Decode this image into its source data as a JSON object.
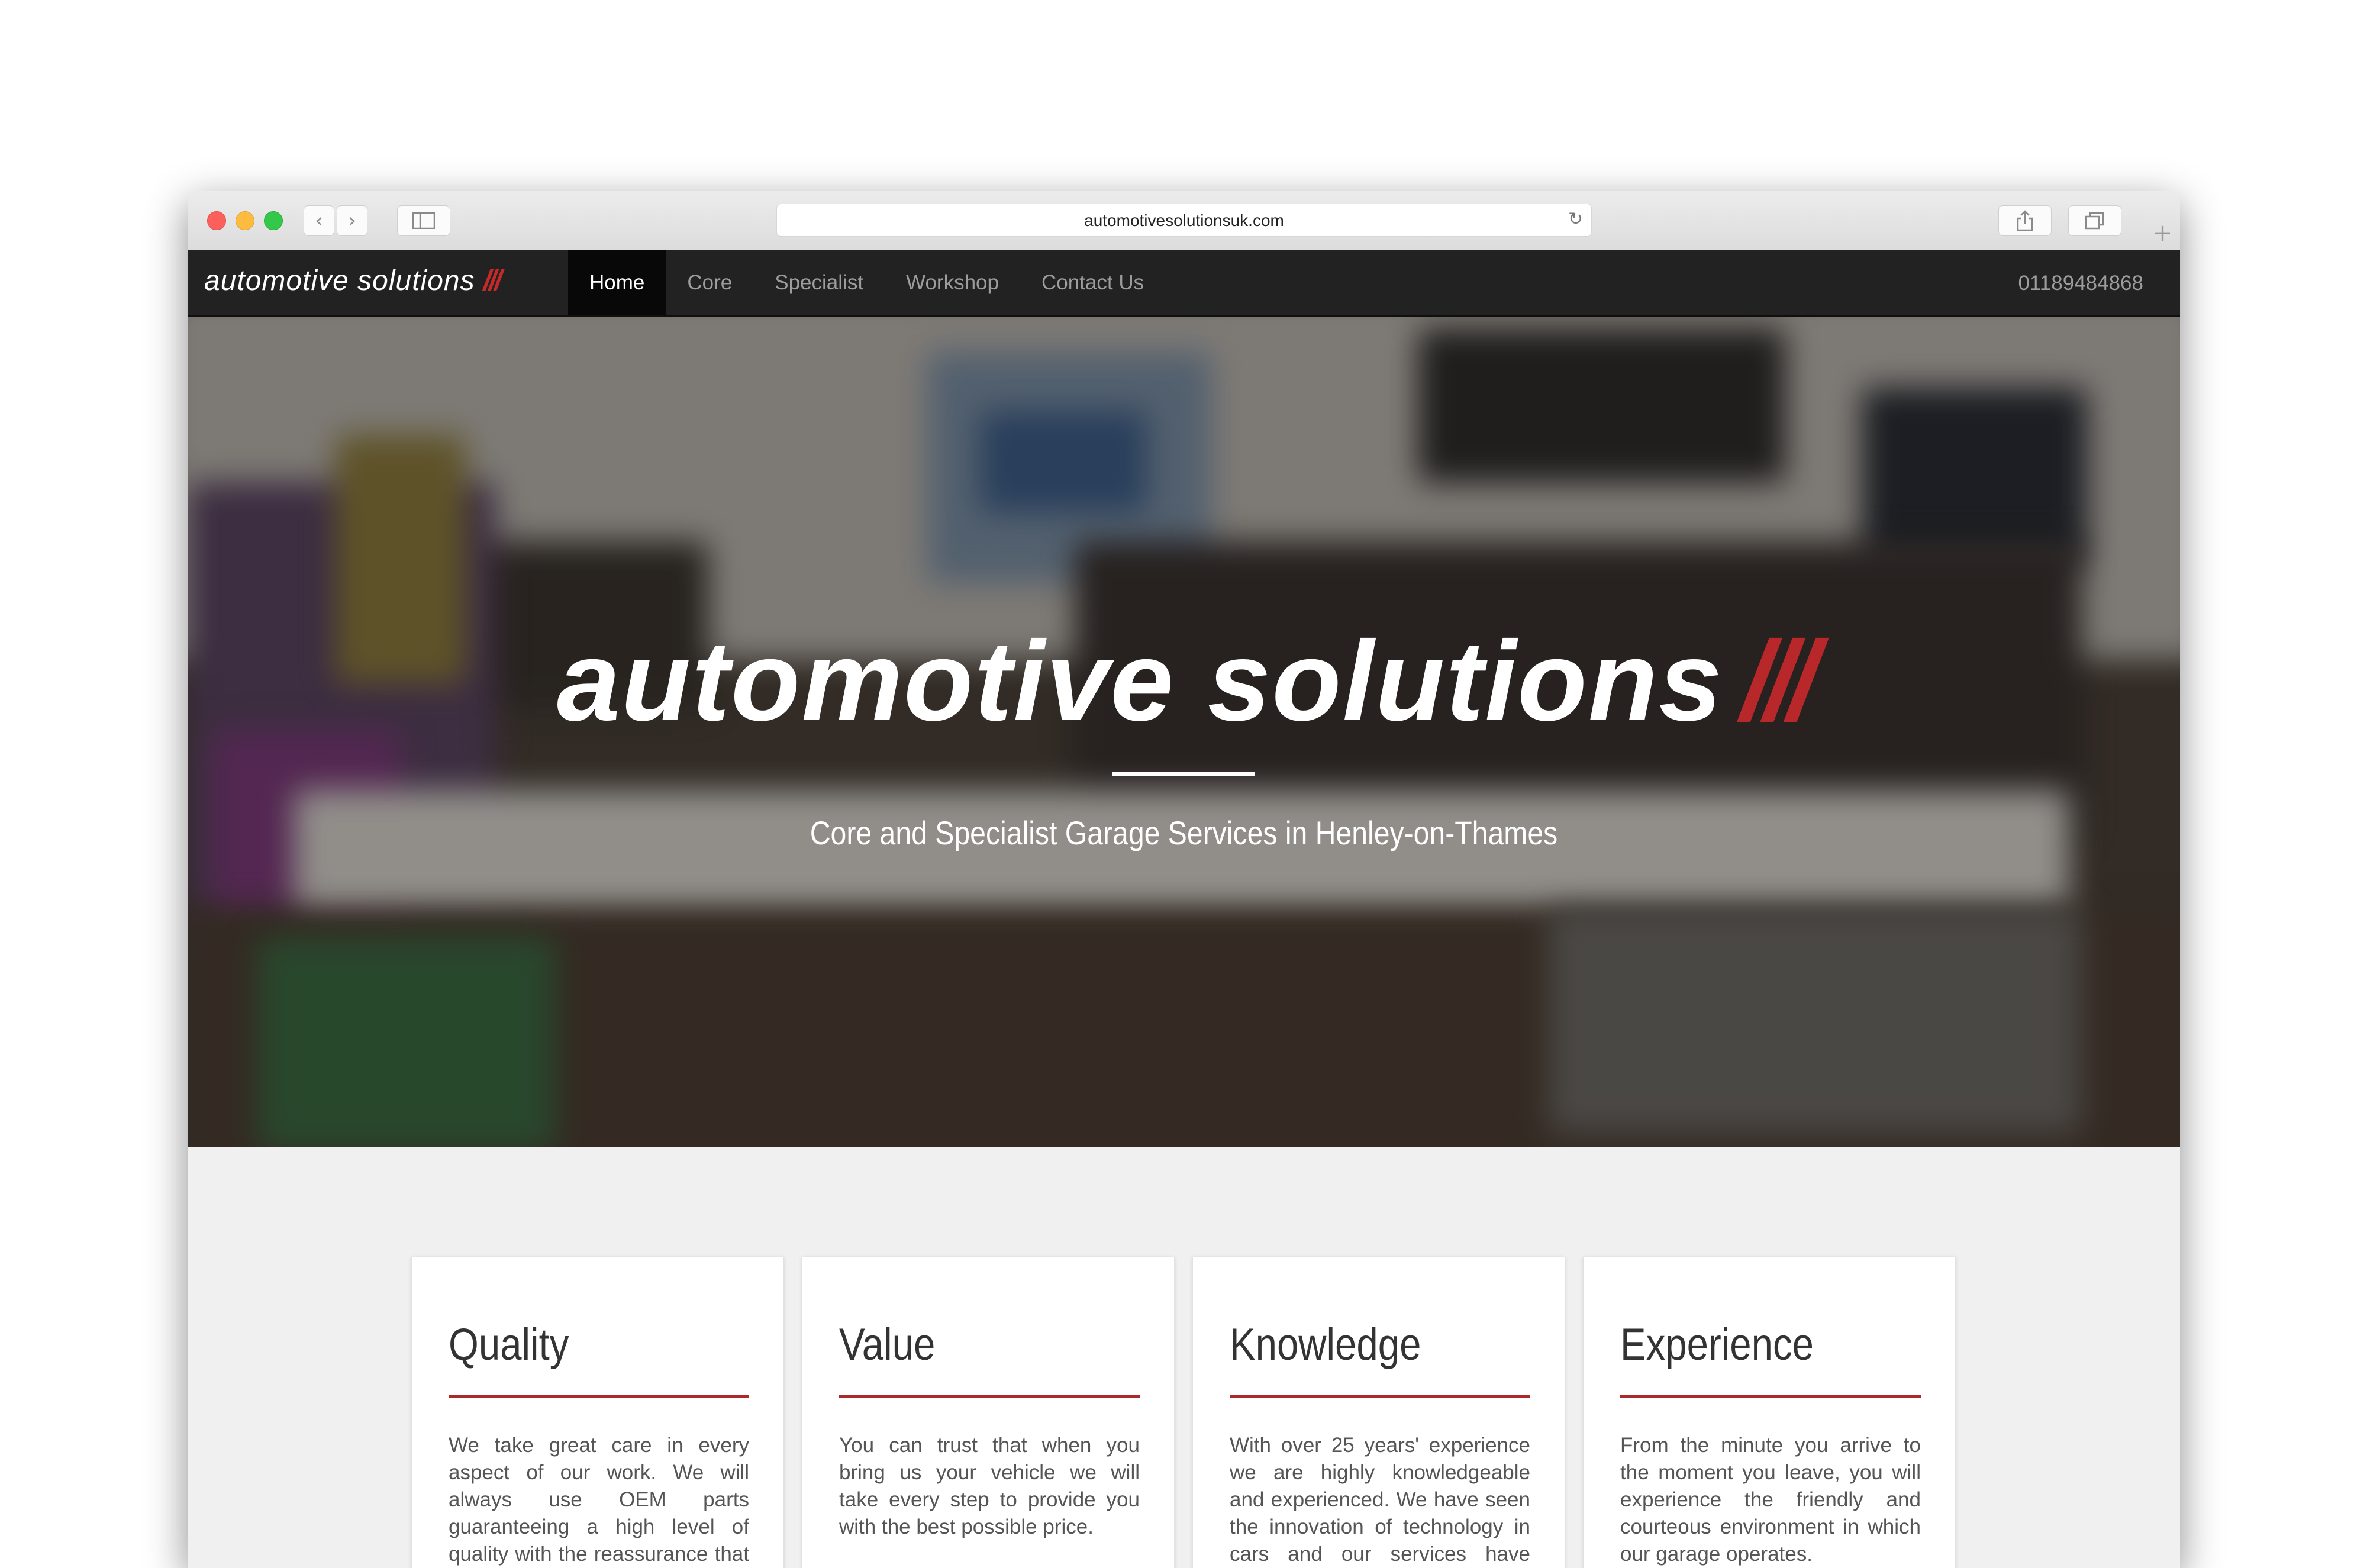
{
  "browser": {
    "url": "automotivesolutionsuk.com",
    "icons": [
      "back-arrow-icon",
      "forward-arrow-icon",
      "sidebar-icon",
      "reload-icon",
      "share-icon",
      "tabs-icon",
      "new-tab-plus-icon"
    ]
  },
  "site_nav": {
    "brand": "automotive solutions",
    "brand_mark": "///",
    "items": [
      {
        "label": "Home",
        "active": true
      },
      {
        "label": "Core",
        "active": false
      },
      {
        "label": "Specialist",
        "active": false
      },
      {
        "label": "Workshop",
        "active": false
      },
      {
        "label": "Contact Us",
        "active": false
      }
    ],
    "phone": "01189484868"
  },
  "hero": {
    "logo_text": "automotive solutions",
    "logo_mark": "///",
    "tagline": "Core and Specialist Garage Services in Henley-on-Thames"
  },
  "cards": [
    {
      "title": "Quality",
      "text": "We take great care in every aspect of our work. We will always use OEM parts guaranteeing a high level of quality with the reassurance that your new parts are"
    },
    {
      "title": "Value",
      "text": "You can trust that when you bring us your vehicle we will take every step to provide you with the best possible price."
    },
    {
      "title": "Knowledge",
      "text": "With over 25 years' experience we are highly knowledgeable and experienced. We have seen the innovation of technology in cars and our services have evolved in line with the"
    },
    {
      "title": "Experience",
      "text": "From the minute you arrive to the moment you leave, you will experience the friendly and courteous environment in which our garage operates."
    }
  ],
  "colors": {
    "nav_bg": "#222222",
    "accent_red": "#b8282a",
    "page_bg": "#f0f0f0"
  }
}
